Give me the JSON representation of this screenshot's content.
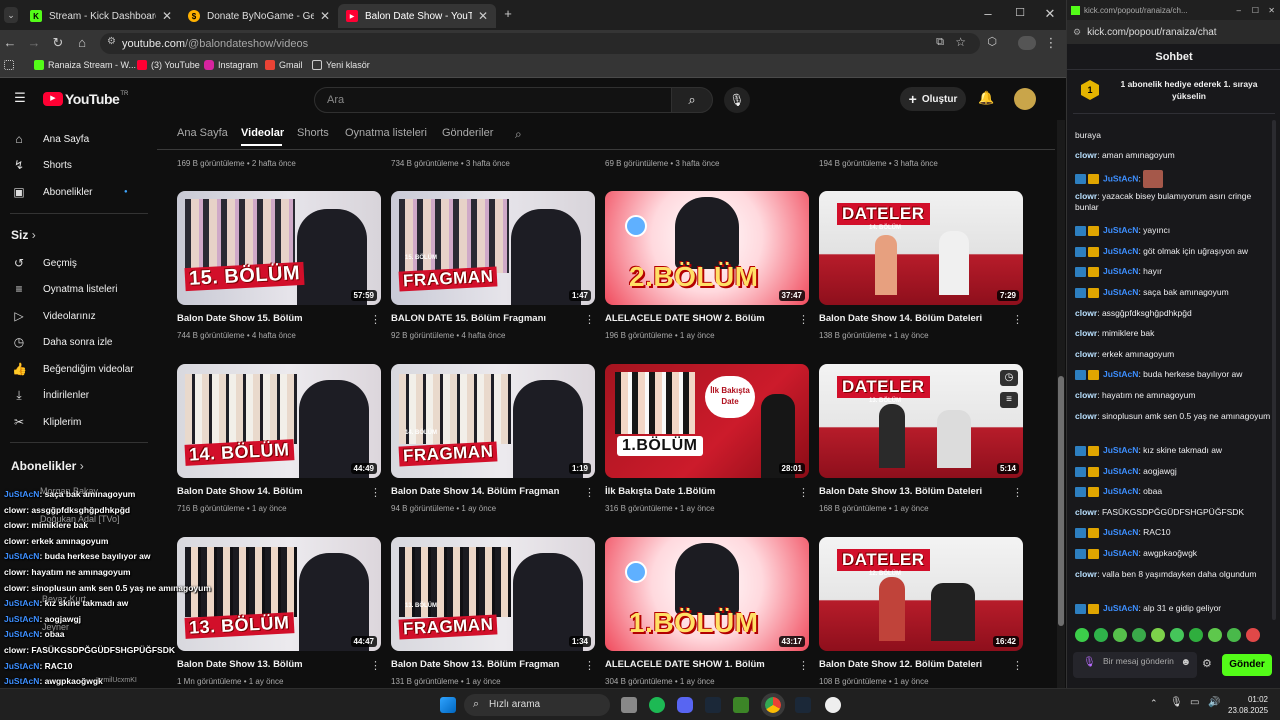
{
  "browser": {
    "tabs": [
      {
        "title": "Stream - Kick Dashboard",
        "icon": "kick-icon",
        "active": false
      },
      {
        "title": "Donate ByNoGame - Gelen/Gi",
        "icon": "coin-icon",
        "active": false
      },
      {
        "title": "Balon Date Show - YouTube",
        "icon": "youtube-icon",
        "active": true
      }
    ],
    "url_host": "youtube.com",
    "url_path": "/@balondateshow/videos",
    "bookmarks": [
      "Ranaiza Stream - W...",
      "(3) YouTube",
      "Instagram",
      "Gmail",
      "Yeni klasör"
    ]
  },
  "youtube": {
    "logo": "YouTube",
    "region": "TR",
    "search_placeholder": "Ara",
    "create_label": "Oluştur",
    "sidebar": {
      "main": [
        {
          "label": "Ana Sayfa",
          "icon": "home-icon"
        },
        {
          "label": "Shorts",
          "icon": "shorts-icon"
        },
        {
          "label": "Abonelikler",
          "icon": "subscriptions-icon"
        }
      ],
      "you_header": "Siz",
      "you": [
        {
          "label": "Geçmiş",
          "icon": "history-icon"
        },
        {
          "label": "Oynatma listeleri",
          "icon": "playlists-icon"
        },
        {
          "label": "Videolarınız",
          "icon": "your-videos-icon"
        },
        {
          "label": "Daha sonra izle",
          "icon": "clock-icon"
        },
        {
          "label": "Beğendiğim videolar",
          "icon": "thumbs-up-icon"
        },
        {
          "label": "İndirilenler",
          "icon": "download-icon"
        },
        {
          "label": "Kliplerim",
          "icon": "scissors-icon"
        }
      ],
      "subs_header": "Abonelikler"
    },
    "channel_tabs": [
      "Ana Sayfa",
      "Videolar",
      "Shorts",
      "Oynatma listeleri",
      "Gönderiler"
    ],
    "top_row_meta": [
      "169 B görüntüleme • 2 hafta önce",
      "734 B görüntüleme • 3 hafta önce",
      "69 B görüntüleme • 3 hafta önce",
      "194 B görüntüleme • 3 hafta önce"
    ],
    "videos": [
      {
        "title": "Balon Date Show 15. Bölüm",
        "meta": "744 B görüntüleme • 4 hafta önce",
        "duration": "57:59",
        "overlay": "15. BÖLÜM"
      },
      {
        "title": "BALON DATE 15. Bölüm Fragmanı",
        "meta": "92 B görüntüleme • 4 hafta önce",
        "duration": "1:47",
        "overlay": "FRAGMAN"
      },
      {
        "title": "ALELACELE DATE SHOW 2. Bölüm",
        "meta": "196 B görüntüleme • 1 ay önce",
        "duration": "37:47",
        "overlay": "2.BÖLÜM"
      },
      {
        "title": "Balon Date Show 14. Bölüm Dateleri",
        "meta": "138 B görüntüleme • 1 ay önce",
        "duration": "7:29",
        "overlay": "DATELER"
      },
      {
        "title": "Balon Date Show 14. Bölüm",
        "meta": "716 B görüntüleme • 1 ay önce",
        "duration": "44:49",
        "overlay": "14. BÖLÜM"
      },
      {
        "title": "Balon Date Show 14. Bölüm Fragman",
        "meta": "94 B görüntüleme • 1 ay önce",
        "duration": "1:19",
        "overlay": "FRAGMAN"
      },
      {
        "title": "İlk Bakışta Date 1.Bölüm",
        "meta": "316 B görüntüleme • 1 ay önce",
        "duration": "28:01",
        "overlay": "1.BÖLÜM"
      },
      {
        "title": "Balon Date Show 13. Bölüm Dateleri",
        "meta": "168 B görüntüleme • 1 ay önce",
        "duration": "5:14",
        "overlay": "DATELER"
      },
      {
        "title": "Balon Date Show 13. Bölüm",
        "meta": "1 Mn görüntüleme • 1 ay önce",
        "duration": "44:47",
        "overlay": "13. BÖLÜM"
      },
      {
        "title": "Balon Date Show 13. Bölüm Fragman",
        "meta": "131 B görüntüleme • 1 ay önce",
        "duration": "1:34",
        "overlay": "FRAGMAN"
      },
      {
        "title": "ALELACELE DATE SHOW 1. Bölüm",
        "meta": "304 B görüntüleme • 1 ay önce",
        "duration": "43:17",
        "overlay": "1.BÖLÜM"
      },
      {
        "title": "Balon Date Show 12. Bölüm Dateleri",
        "meta": "108 B görüntüleme • 1 ay önce",
        "duration": "16:42",
        "overlay": "DATELER"
      }
    ],
    "thumb_sublabels": [
      "14. BÖLÜM",
      "13. BÖLÜM",
      "12. BÖLÜM",
      "İlk Bakışta Date",
      "15. BÖLÜM",
      "14. BÖLÜM",
      "13. BÖLÜM"
    ]
  },
  "kick_chat": {
    "url": "kick.com/popout/ranaiza/chat",
    "url_title": "kick.com/popout/ranaiza/ch...",
    "header": "Sohbet",
    "pinned": "1 abonelik hediye ederek 1. sıraya yükselin",
    "pinned_rank": "1",
    "messages": [
      {
        "user": "",
        "text": "buraya"
      },
      {
        "user": "clowr",
        "text": "aman amınagoyum"
      },
      {
        "user": "JuStAcN",
        "text": ""
      },
      {
        "user": "clowr",
        "text": "yazacak bisey bulamıyorum asırı cringe bunlar"
      },
      {
        "user": "JuStAcN",
        "text": "yayıncı"
      },
      {
        "user": "JuStAcN",
        "text": "göt olmak için uğraşıyon aw"
      },
      {
        "user": "JuStAcN",
        "text": "hayır"
      },
      {
        "user": "JuStAcN",
        "text": "saça bak amınagoyum"
      },
      {
        "user": "clowr",
        "text": "assgğpfdksghğpdhkpğd"
      },
      {
        "user": "clowr",
        "text": "mimiklere bak"
      },
      {
        "user": "clowr",
        "text": "erkek amınagoyum"
      },
      {
        "user": "JuStAcN",
        "text": "buda herkese bayılıyor aw"
      },
      {
        "user": "clowr",
        "text": "hayatım ne amınagoyum"
      },
      {
        "user": "clowr",
        "text": "sinoplusun amk sen 0.5 yaş ne amınagoyum"
      },
      {
        "user": "JuStAcN",
        "text": "kız skine takmadı aw"
      },
      {
        "user": "JuStAcN",
        "text": "aogjawgj"
      },
      {
        "user": "JuStAcN",
        "text": "obaa"
      },
      {
        "user": "clowr",
        "text": "FASÜKGSDPĞGÜDFSHGPÜĞFSDK"
      },
      {
        "user": "JuStAcN",
        "text": "RAC10"
      },
      {
        "user": "JuStAcN",
        "text": "awgpkaoğwgk"
      },
      {
        "user": "clowr",
        "text": "valla ben 8 yaşımdayken daha olgundum"
      },
      {
        "user": "JuStAcN",
        "text": "alp 31 e gidip geliyor"
      }
    ],
    "input_placeholder": "Bir mesaj gönderin",
    "send_label": "Gönder",
    "colors": {
      "clowr": "#b9e0ff",
      "JuStAcN": "#3d8fff",
      "send": "#53fc18"
    }
  },
  "overlay_chat": [
    {
      "user": "JuStAcN",
      "text": "saça bak amınagoyum"
    },
    {
      "user": "clowr",
      "text": "assgğpfdksghğpdhkpğd"
    },
    {
      "user": "clowr",
      "text": "mimiklere bak"
    },
    {
      "user": "clowr",
      "text": "erkek amınagoyum"
    },
    {
      "user": "JuStAcN",
      "text": "buda herkese bayılıyor aw"
    },
    {
      "user": "clowr",
      "text": "hayatım ne amınagoyum"
    },
    {
      "user": "clowr",
      "text": "sinoplusun amk sen 0.5 yaş ne amınagoyum"
    },
    {
      "user": "JuStAcN",
      "text": "kız skine takmadı aw"
    },
    {
      "user": "JuStAcN",
      "text": "aogjawgj"
    },
    {
      "user": "JuStAcN",
      "text": "obaa"
    },
    {
      "user": "clowr",
      "text": "FASÜKGSDPĞGÜDFSHGPÜĞFSDK"
    },
    {
      "user": "JuStAcN",
      "text": "RAC10"
    },
    {
      "user": "JuStAcN",
      "text": "awgpkaoğwgk"
    },
    {
      "user": "clowr",
      "text": "valla ben 8 yaşımdayken daha olgundum"
    },
    {
      "user": "JuStAcN",
      "text": "alp 31 e gidip geliyor"
    }
  ],
  "overlay_subs_ghost": [
    "Morgan Bakay",
    "Doğukan Adal [TVo]",
    "Beyaz Kurt",
    "Jeyner",
    "ItzmilUcxmKI"
  ],
  "taskbar": {
    "search_placeholder": "Hızlı arama",
    "time": "01:02",
    "date": "23.08.2025"
  }
}
